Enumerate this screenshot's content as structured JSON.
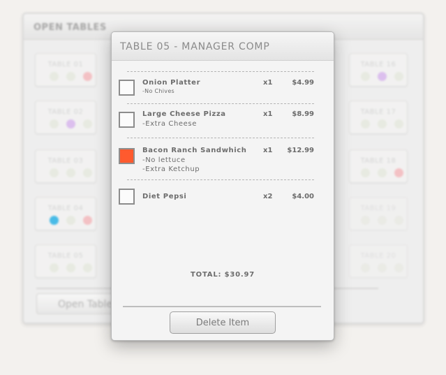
{
  "background": {
    "title": "OPEN TABLES",
    "open_button_label": "Open Table",
    "tables": [
      {
        "label": "TABLE 01",
        "dots": [
          "",
          "",
          "red"
        ]
      },
      {
        "label": "TABLE 02",
        "dots": [
          "",
          "purple",
          ""
        ]
      },
      {
        "label": "TABLE 03",
        "dots": [
          "",
          "",
          ""
        ]
      },
      {
        "label": "TABLE 04",
        "dots": [
          "blue",
          "",
          "red"
        ]
      },
      {
        "label": "TABLE 05",
        "dots": [
          "",
          "",
          ""
        ]
      },
      {
        "label": "TABLE 16",
        "dots": [
          "",
          "purple",
          ""
        ]
      },
      {
        "label": "TABLE 17",
        "dots": [
          "",
          "",
          ""
        ]
      },
      {
        "label": "TABLE 18",
        "dots": [
          "",
          "",
          "red"
        ]
      },
      {
        "label": "TABLE 19",
        "dots": [
          "",
          "",
          ""
        ]
      },
      {
        "label": "TABLE 20",
        "dots": [
          "",
          "",
          ""
        ]
      }
    ]
  },
  "dialog": {
    "title": "TABLE 05 - MANAGER COMP",
    "items": [
      {
        "name": "Onion Platter",
        "mods": [
          "-No Chives"
        ],
        "qty": "x1",
        "price": "$4.99",
        "checked": false
      },
      {
        "name": "Large Cheese Pizza",
        "mods": [
          "-Extra Cheese"
        ],
        "qty": "x1",
        "price": "$8.99",
        "checked": false
      },
      {
        "name": "Bacon Ranch Sandwhich",
        "mods": [
          "-No lettuce",
          "-Extra Ketchup"
        ],
        "qty": "x1",
        "price": "$12.99",
        "checked": true
      },
      {
        "name": "Diet Pepsi",
        "mods": [],
        "qty": "x2",
        "price": "$4.00",
        "checked": false
      }
    ],
    "total": "TOTAL:  $30.97",
    "delete_label": "Delete Item"
  },
  "colors": {
    "checked": "#ff5a2e",
    "dot_red": "#f4b9bd",
    "dot_purple": "#d8b7ee",
    "dot_blue": "#2bb2e6"
  }
}
